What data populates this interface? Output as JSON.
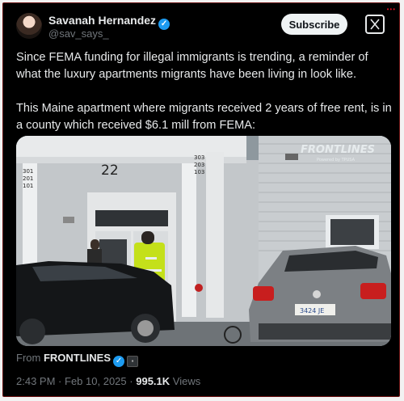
{
  "author": {
    "name": "Savanah Hernandez",
    "handle": "@sav_says_"
  },
  "actions": {
    "subscribe_label": "Subscribe"
  },
  "tweet": {
    "paragraph1": "Since FEMA funding for illegal immigrants is trending, a reminder of what the luxury apartments migrants have been living in look like.",
    "paragraph2": "This Maine apartment where migrants received 2 years of free rent, is in a county which received $6.1 mill from FEMA:"
  },
  "media": {
    "watermark": "FRONTLINES",
    "watermark_sub": "Powered by TPUSA",
    "building_number": "22",
    "unit_numbers_left": [
      "301",
      "201",
      "101"
    ],
    "unit_numbers_right": [
      "303",
      "203",
      "103"
    ],
    "license_plate": "3424 JE"
  },
  "source": {
    "prefix": "From",
    "name": "FRONTLINES"
  },
  "meta": {
    "time": "2:43 PM",
    "separator": "·",
    "date": "Feb 10, 2025",
    "views_count": "995.1K",
    "views_label": "Views"
  },
  "colors": {
    "background": "#000000",
    "text": "#e7e9ea",
    "muted": "#71767b",
    "verified": "#1d9bf0"
  },
  "icons": [
    "verified-badge-icon",
    "x-logo-icon"
  ]
}
